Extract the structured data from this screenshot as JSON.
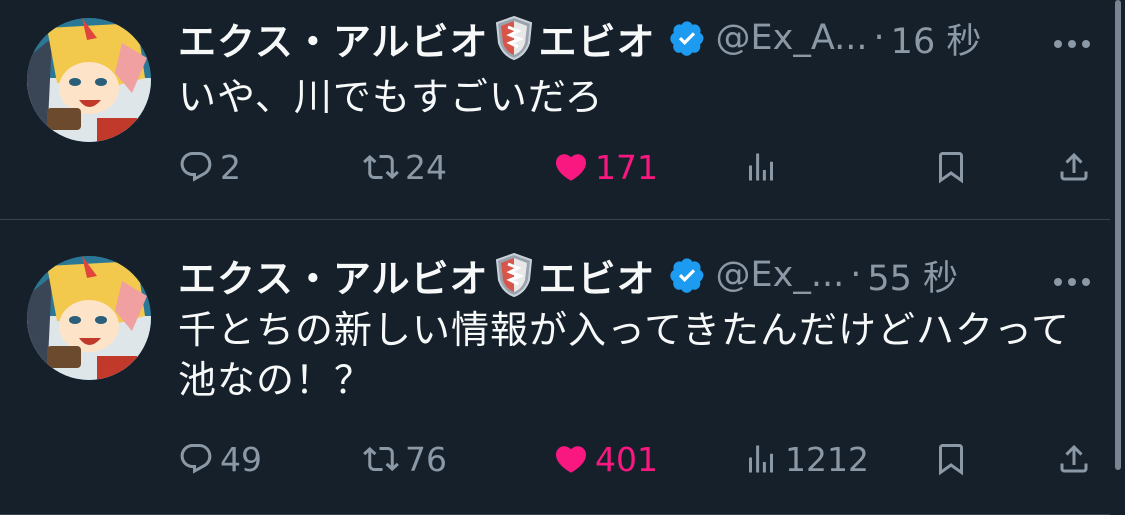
{
  "colors": {
    "background": "#15202b",
    "text_primary": "#f7f9f9",
    "text_secondary": "#8b98a5",
    "like_active": "#f91880",
    "verified": "#1d9bf0",
    "divider": "#38444d"
  },
  "tweets": [
    {
      "name_part1": "エクス・アルビオ",
      "name_part2": "エビオ",
      "handle": "@Ex_A...",
      "separator": "·",
      "time": "16 秒",
      "text": "いや、川でもすごいだろ",
      "reply_count": "2",
      "retweet_count": "24",
      "like_count": "171",
      "view_count": "",
      "liked": true,
      "verified": true
    },
    {
      "name_part1": "エクス・アルビオ",
      "name_part2": "エビオ",
      "handle": "@Ex_...",
      "separator": "·",
      "time": "55 秒",
      "text": "千とちの新しい情報が入ってきたんだけどハクって池なの！？",
      "reply_count": "49",
      "retweet_count": "76",
      "like_count": "401",
      "view_count": "1212",
      "liked": true,
      "verified": true
    }
  ],
  "icons": {
    "avatar": "avatar-image",
    "shield": "shield-emoji-icon",
    "verified": "verified-badge-icon",
    "more": "more-options-icon",
    "reply": "reply-icon",
    "retweet": "retweet-icon",
    "like": "heart-icon",
    "views": "views-icon",
    "bookmark": "bookmark-icon",
    "share": "share-icon"
  }
}
